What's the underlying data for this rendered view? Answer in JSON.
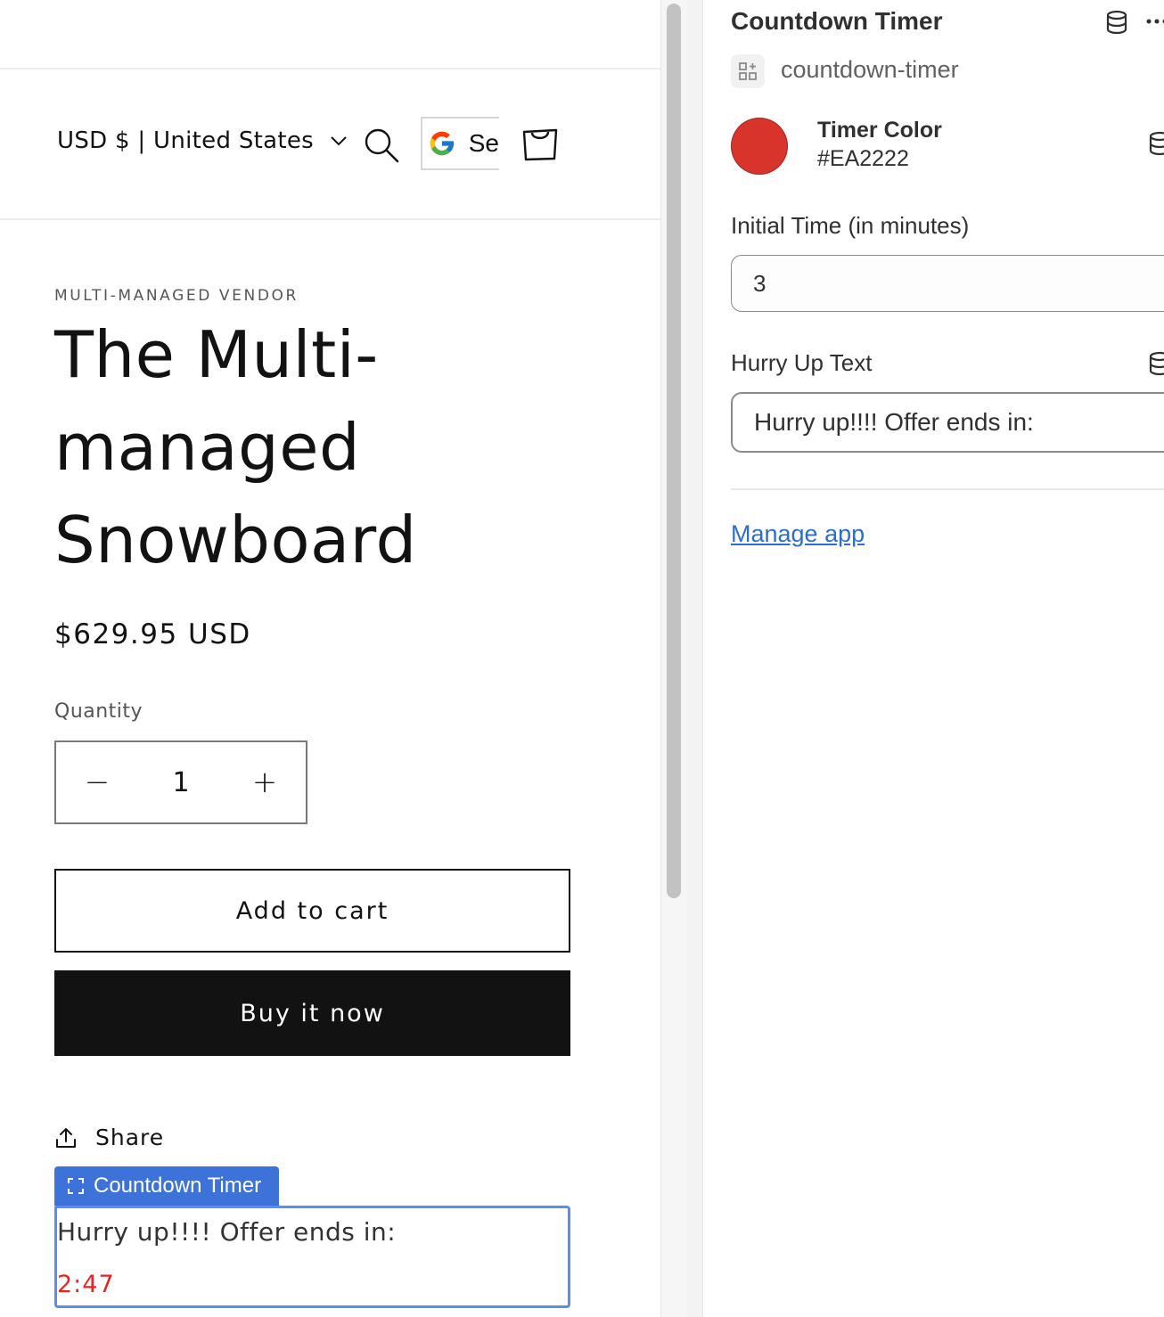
{
  "preview": {
    "currency_selector": "USD $ | United States",
    "google_button_text": "Se",
    "product": {
      "vendor": "MULTI-MANAGED VENDOR",
      "title": "The Multi-managed Snowboard",
      "price": "$629.95 USD",
      "quantity_label": "Quantity",
      "quantity_value": "1",
      "quantity_decrease": "−",
      "quantity_increase": "+",
      "add_to_cart": "Add to cart",
      "buy_now": "Buy it now",
      "share": "Share"
    },
    "app_block": {
      "tag_label": "Countdown Timer",
      "hurry_text": "Hurry up!!!! Offer ends in:",
      "timer_value": "2:47"
    }
  },
  "panel": {
    "title": "Countdown Timer",
    "handle": "countdown-timer",
    "timer_color": {
      "label": "Timer Color",
      "value": "#EA2222"
    },
    "initial_time": {
      "label": "Initial Time (in minutes)",
      "value": "3"
    },
    "hurry_up": {
      "label": "Hurry Up Text",
      "value": "Hurry up!!!! Offer ends in:"
    },
    "manage_link": "Manage app"
  },
  "colors": {
    "timer": "#EA2222",
    "selection_blue": "#3d73d8",
    "buy_now_bg": "#121212",
    "link": "#2c6ecb"
  },
  "icons": [
    "chevron-down-icon",
    "search-icon",
    "google-icon",
    "cart-icon",
    "share-icon",
    "block-select-icon",
    "database-icon",
    "more-icon",
    "app-block-icon"
  ]
}
